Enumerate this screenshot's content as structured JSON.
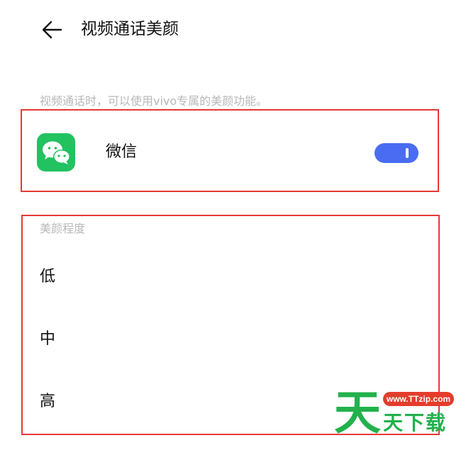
{
  "header": {
    "back_icon": "arrow-left-icon",
    "title": "视频通话美颜"
  },
  "description": "视频通话时，可以使用vivo专属的美颜功能。",
  "app": {
    "icon": "wechat-icon",
    "name": "微信",
    "toggle_on": true,
    "toggle_color": "#4a6cf2"
  },
  "beauty_level": {
    "label": "美颜程度",
    "options": [
      "低",
      "中",
      "高"
    ]
  },
  "watermark": {
    "url": "www.TTzip.com",
    "big_char": "天",
    "text": "天下载",
    "color": "#22b14c"
  },
  "colors": {
    "highlight_border": "#e53935",
    "wechat_green": "#22c260",
    "muted_text": "#b8b8b8"
  }
}
